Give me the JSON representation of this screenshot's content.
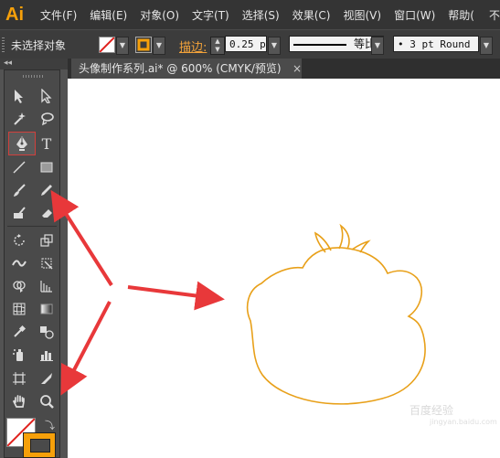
{
  "app": {
    "logo": "Ai"
  },
  "menu": {
    "items": [
      "文件(F)",
      "编辑(E)",
      "对象(O)",
      "文字(T)",
      "选择(S)",
      "效果(C)",
      "视图(V)",
      "窗口(W)",
      "帮助("
    ],
    "extra": "不"
  },
  "control_bar": {
    "selection_label": "未选择对象",
    "stroke_label": "描边:",
    "stroke_weight": "0.25 p",
    "stroke_style_label": "等比",
    "brush_label": "• 3 pt Round"
  },
  "document": {
    "tab_title": "头像制作系列.ai* @ 600% (CMYK/预览)",
    "close_glyph": "×"
  },
  "colors": {
    "accent": "#f6a00a",
    "drawing_stroke": "#e8a019",
    "arrow": "#e8383a",
    "selected_tool_border": "#d0403c"
  },
  "toolbox": {
    "selected_tool": "pen-tool",
    "icons": [
      "selection",
      "direct-selection",
      "magic-wand",
      "lasso",
      "pen",
      "type",
      "line-segment",
      "rectangle",
      "paintbrush",
      "pencil",
      "blob-brush",
      "eraser",
      "rotate",
      "scale",
      "width",
      "free-transform",
      "shape-builder",
      "perspective-grid",
      "mesh",
      "gradient",
      "eyedropper",
      "blend",
      "symbol-sprayer",
      "column-graph",
      "artboard",
      "slice",
      "hand",
      "zoom"
    ]
  },
  "watermark": {
    "text": "百度经验",
    "sub": "jingyan.baidu.com"
  }
}
